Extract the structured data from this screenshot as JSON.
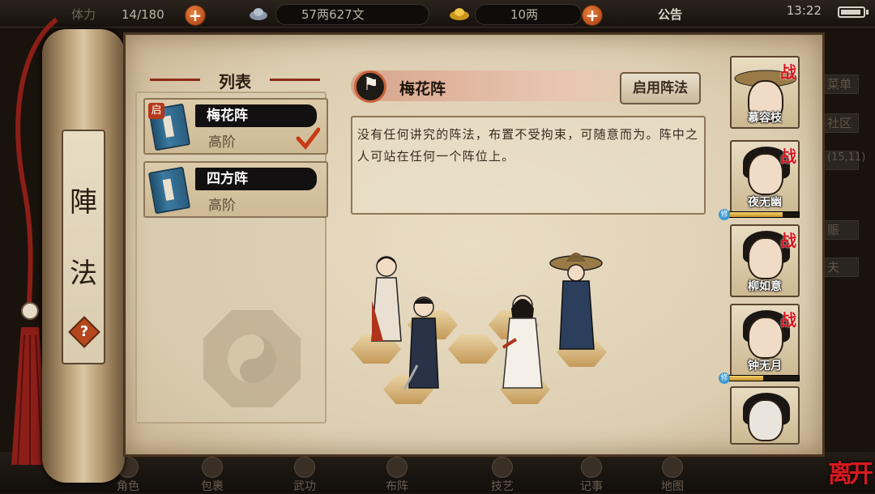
{
  "topbar": {
    "stamina_label": "体力",
    "stamina_value": "14/180",
    "silver_value": "57两627文",
    "gold_value": "10两",
    "notice_label": "公告",
    "time": "13:22"
  },
  "list": {
    "header": "列表",
    "items": [
      {
        "name": "梅花阵",
        "rank": "高阶",
        "badge": "启",
        "selected": true
      },
      {
        "name": "四方阵",
        "rank": "高阶"
      }
    ]
  },
  "scroll": {
    "title_top": "陣",
    "title_bottom": "法",
    "help_label": "?"
  },
  "formation": {
    "title": "梅花阵",
    "enable_label": "启用阵法",
    "description": "没有任何讲究的阵法，布置不受拘束，可随意而为。阵中之人可站在任何一个阵位上。"
  },
  "roster": [
    {
      "name": "慕容枝",
      "zhan": "战"
    },
    {
      "name": "夜无幽",
      "zhan": "战",
      "cultivate": "修"
    },
    {
      "name": "柳如意",
      "zhan": "战"
    },
    {
      "name": "钟无月",
      "zhan": "战",
      "cultivate": "修"
    },
    {
      "name": "",
      "zhan": ""
    }
  ],
  "side_menu": [
    "菜单",
    "社区",
    "(15,11)",
    "赈",
    "夫"
  ],
  "bottom_nav": [
    "角色",
    "包裹",
    "武功",
    "布阵",
    "技艺",
    "记事",
    "地图"
  ],
  "leave_label": "离开",
  "colors": {
    "accent_red": "#b4391a",
    "panel_bg": "#e2d5ba",
    "zhan_red": "#d9141e"
  }
}
